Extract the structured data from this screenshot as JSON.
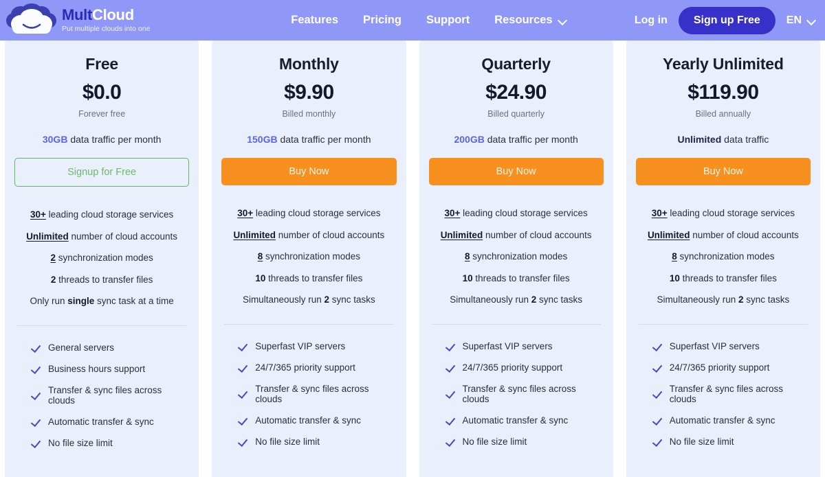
{
  "header": {
    "logo_icon": "cloud-smile-logo",
    "brand_part1": "Mult",
    "brand_part2": "Cloud",
    "tagline": "Put multiple clouds into one",
    "nav": [
      {
        "label": "Features",
        "has_caret": false
      },
      {
        "label": "Pricing",
        "has_caret": false
      },
      {
        "label": "Support",
        "has_caret": false
      },
      {
        "label": "Resources",
        "has_caret": true
      }
    ],
    "login_label": "Log in",
    "signup_label": "Sign up Free",
    "language": "EN",
    "caret_icon": "chevron-down-icon",
    "bg_color": "#9098f7",
    "signup_color": "#3730c9"
  },
  "plans": [
    {
      "name": "Free",
      "price": "$0.0",
      "billing": "Forever free",
      "traffic_highlight": "30GB",
      "traffic_highlight_style": "accent",
      "traffic_rest": "data traffic per month",
      "cta_label": "Signup for Free",
      "cta_style": "free",
      "specs": [
        {
          "u": "30+",
          "b": "",
          "pre": "",
          "post": "leading cloud storage services"
        },
        {
          "u": "Unlimited",
          "b": "",
          "pre": "",
          "post": "number of cloud accounts"
        },
        {
          "u": "2",
          "b": "",
          "pre": "",
          "post": "synchronization modes"
        },
        {
          "u": "",
          "b": "2",
          "pre": "",
          "post": "threads to transfer files"
        },
        {
          "u": "",
          "b": "single",
          "pre": "Only run",
          "post": "sync task at a time"
        }
      ],
      "perks": [
        "General servers",
        "Business hours support",
        "Transfer & sync files across clouds",
        "Automatic transfer & sync",
        "No file size limit"
      ]
    },
    {
      "name": "Monthly",
      "price": "$9.90",
      "billing": "Billed monthly",
      "traffic_highlight": "150GB",
      "traffic_highlight_style": "accent",
      "traffic_rest": "data traffic per month",
      "cta_label": "Buy Now",
      "cta_style": "buy",
      "specs": [
        {
          "u": "30+",
          "b": "",
          "pre": "",
          "post": "leading cloud storage services"
        },
        {
          "u": "Unlimited",
          "b": "",
          "pre": "",
          "post": "number of cloud accounts"
        },
        {
          "u": "8",
          "b": "",
          "pre": "",
          "post": "synchronization modes"
        },
        {
          "u": "",
          "b": "10",
          "pre": "",
          "post": "threads to transfer files"
        },
        {
          "u": "",
          "b": "2",
          "pre": "Simultaneously run",
          "post": "sync tasks"
        }
      ],
      "perks": [
        "Superfast VIP servers",
        "24/7/365 priority support",
        "Transfer & sync files across clouds",
        "Automatic transfer & sync",
        "No file size limit"
      ]
    },
    {
      "name": "Quarterly",
      "price": "$24.90",
      "billing": "Billed quarterly",
      "traffic_highlight": "200GB",
      "traffic_highlight_style": "accent",
      "traffic_rest": "data traffic per month",
      "cta_label": "Buy Now",
      "cta_style": "buy",
      "specs": [
        {
          "u": "30+",
          "b": "",
          "pre": "",
          "post": "leading cloud storage services"
        },
        {
          "u": "Unlimited",
          "b": "",
          "pre": "",
          "post": "number of cloud accounts"
        },
        {
          "u": "8",
          "b": "",
          "pre": "",
          "post": "synchronization modes"
        },
        {
          "u": "",
          "b": "10",
          "pre": "",
          "post": "threads to transfer files"
        },
        {
          "u": "",
          "b": "2",
          "pre": "Simultaneously run",
          "post": "sync tasks"
        }
      ],
      "perks": [
        "Superfast VIP servers",
        "24/7/365 priority support",
        "Transfer & sync files across clouds",
        "Automatic transfer & sync",
        "No file size limit"
      ]
    },
    {
      "name": "Yearly Unlimited",
      "price": "$119.90",
      "billing": "Billed annually",
      "traffic_highlight": "Unlimited",
      "traffic_highlight_style": "dark",
      "traffic_rest": "data traffic",
      "cta_label": "Buy Now",
      "cta_style": "buy",
      "specs": [
        {
          "u": "30+",
          "b": "",
          "pre": "",
          "post": "leading cloud storage services"
        },
        {
          "u": "Unlimited",
          "b": "",
          "pre": "",
          "post": "number of cloud accounts"
        },
        {
          "u": "8",
          "b": "",
          "pre": "",
          "post": "synchronization modes"
        },
        {
          "u": "",
          "b": "10",
          "pre": "",
          "post": "threads to transfer files"
        },
        {
          "u": "",
          "b": "2",
          "pre": "Simultaneously run",
          "post": "sync tasks"
        }
      ],
      "perks": [
        "Superfast VIP servers",
        "24/7/365 priority support",
        "Transfer & sync files across clouds",
        "Automatic transfer & sync",
        "No file size limit"
      ]
    }
  ],
  "colors": {
    "accent_purple": "#5b63e8",
    "buy_orange": "#f7901e",
    "free_green": "#5cb85c",
    "check_purple": "#4b45c9",
    "card_bg": "#e9f0fb"
  }
}
